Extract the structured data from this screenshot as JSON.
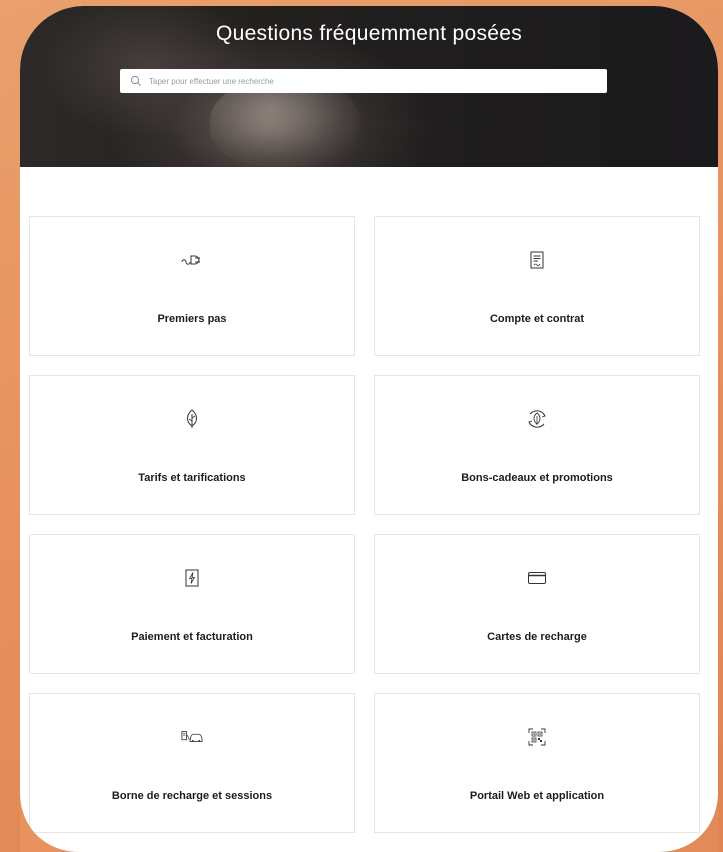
{
  "header": {
    "title": "Questions fréquemment posées"
  },
  "search": {
    "placeholder": "Taper pour effectuer une recherche",
    "icon": "search-icon"
  },
  "categories": [
    {
      "label": "Premiers pas",
      "icon": "plug-icon"
    },
    {
      "label": "Compte et contrat",
      "icon": "document-icon"
    },
    {
      "label": "Tarifs et tarifications",
      "icon": "leaf-icon"
    },
    {
      "label": "Bons-cadeaux et promotions",
      "icon": "leaf-cycle-icon"
    },
    {
      "label": "Paiement et facturation",
      "icon": "bolt-card-icon"
    },
    {
      "label": "Cartes de recharge",
      "icon": "credit-card-icon"
    },
    {
      "label": "Borne de recharge et sessions",
      "icon": "charging-car-icon"
    },
    {
      "label": "Portail Web et application",
      "icon": "qr-code-icon"
    }
  ],
  "colors": {
    "background_orange": "#e7925f",
    "hero_dark": "#1f1d1d",
    "card_border": "#e6e6e6",
    "text_dark": "#1c1c1c"
  }
}
